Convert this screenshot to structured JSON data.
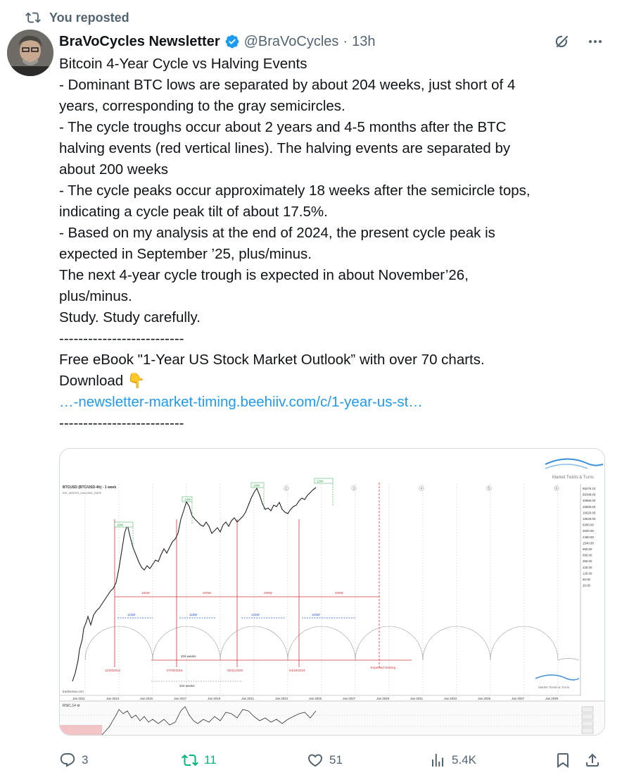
{
  "repost": {
    "label": "You reposted",
    "icon": "repost-icon"
  },
  "author": {
    "name": "BraVoCycles Newsletter",
    "handle": "@BraVoCycles",
    "separator": "·",
    "time": "13h",
    "verified_color": "#1d9bf0"
  },
  "tweet_lines": [
    "Bitcoin 4-Year Cycle vs Halving Events",
    "- Dominant BTC lows are separated by about 204 weeks, just short of 4",
    "years, corresponding to the gray semicircles.",
    "- The cycle troughs occur about 2 years and 4-5 months after the BTC",
    "halving events (red vertical lines). The halving events are separated by",
    "about 200 weeks",
    "- The cycle peaks occur approximately 18 weeks after the semicircle tops,",
    "indicating a cycle peak tilt of about 17.5%.",
    "- Based on my analysis at the end of 2024, the present cycle peak is",
    "expected in September ’25, plus/minus.",
    "The next 4-year cycle trough is expected in about November’26,",
    "plus/minus.",
    "Study. Study carefully.",
    "--------------------------",
    "Free eBook \"1-Year US Stock Market Outlook” with over 70 charts.",
    "Download"
  ],
  "download_emoji": "👇",
  "link_text": "…-newsletter-market-timing.beehiiv.com/c/1-year-us-st…",
  "divider_bottom": "--------------------------",
  "chart": {
    "header": "BTCUSD (BTC/USD-4h) - 1 week",
    "subheader": "EW_WEEKS_HALVING_DATE",
    "watermark_top": "Market Twists & Turns",
    "watermark_bottom": "Market Twists & Turns",
    "source": "tradinview.com",
    "rsi_label": "RSIC,14 ⚙",
    "x_ticks": [
      "Jan 2011",
      "Jan 2013",
      "Jan 2015",
      "Jan 2017",
      "Jan 2019",
      "Jan 2021",
      "Jan 2023",
      "Jan 2025",
      "Jan 2027",
      "Jan 2029",
      "Jan 2031",
      "Jan 2033",
      "Jan 2035",
      "Jan 2037",
      "Jan 2039"
    ],
    "y_ticks": [
      "65476.10",
      "66348.00",
      "40960.00",
      "25600.00",
      "16020.00",
      "10640.00",
      "6300.00",
      "3620.00",
      "2460.00",
      "1540.00",
      "960.00",
      "560.00",
      "360.00",
      "220.00",
      "120.00",
      "60.00",
      "20.00"
    ],
    "halving_dates": [
      "11/28/2012",
      "07/09/2016",
      "05/11/2020",
      "04/19/2024"
    ],
    "expected_halving": "Expected Halving",
    "span_labels_200": [
      "182W",
      "200W",
      "208W",
      "205W"
    ],
    "span_labels_peak": [
      "113W",
      "118W",
      "123W",
      "103W"
    ],
    "peak_lag_labels": [
      "16W",
      "18W",
      "18W",
      "22W"
    ],
    "low_span_label": "204 weeks",
    "bottom_span_label": "204 weeks",
    "top_markers": [
      "1",
      "2",
      "3",
      "4",
      "5",
      "6"
    ],
    "accent_red": "#d8343d",
    "accent_green": "#2aa24a",
    "accent_blue": "#2255d8"
  },
  "actions": {
    "reply_count": "3",
    "retweet_count": "11",
    "like_count": "51",
    "views_count": "5.4K"
  }
}
